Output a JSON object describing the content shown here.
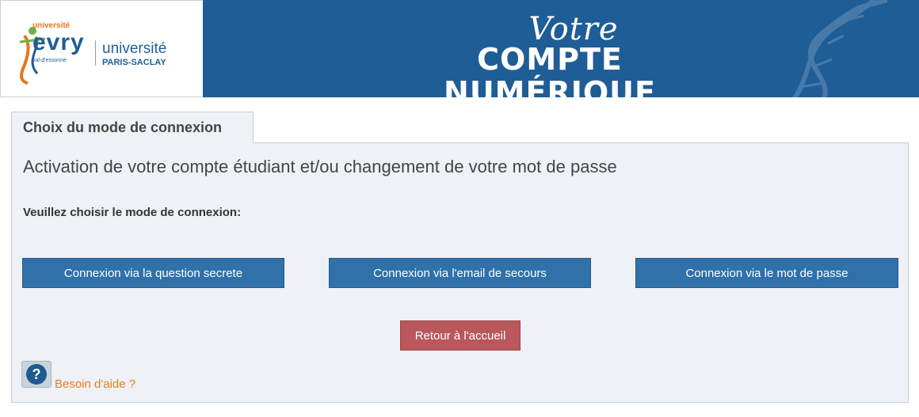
{
  "logo": {
    "text_univ": "université",
    "text_evry": "evry",
    "text_val": "val-d'essonne",
    "text_paris1": "université",
    "text_paris2": "PARIS-SACLAY"
  },
  "banner": {
    "votre": "Votre",
    "compte": "COMPTE NUMÉRIQUE"
  },
  "tab": {
    "label": "Choix du mode de connexion"
  },
  "panel": {
    "title": "Activation de votre compte étudiant et/ou changement de votre mot de passe",
    "prompt": "Veuillez choisir le mode de connexion:",
    "buttons": {
      "question": "Connexion via la question secrete",
      "email": "Connexion via l'email de secours",
      "password": "Connexion via le mot de passe",
      "back": "Retour à l'accueil"
    },
    "help": "Besoin d'aide ?"
  },
  "colors": {
    "banner": "#1f5d96",
    "primary_button": "#3071a9",
    "back_button": "#b9575d",
    "help_link": "#e67e1e"
  }
}
